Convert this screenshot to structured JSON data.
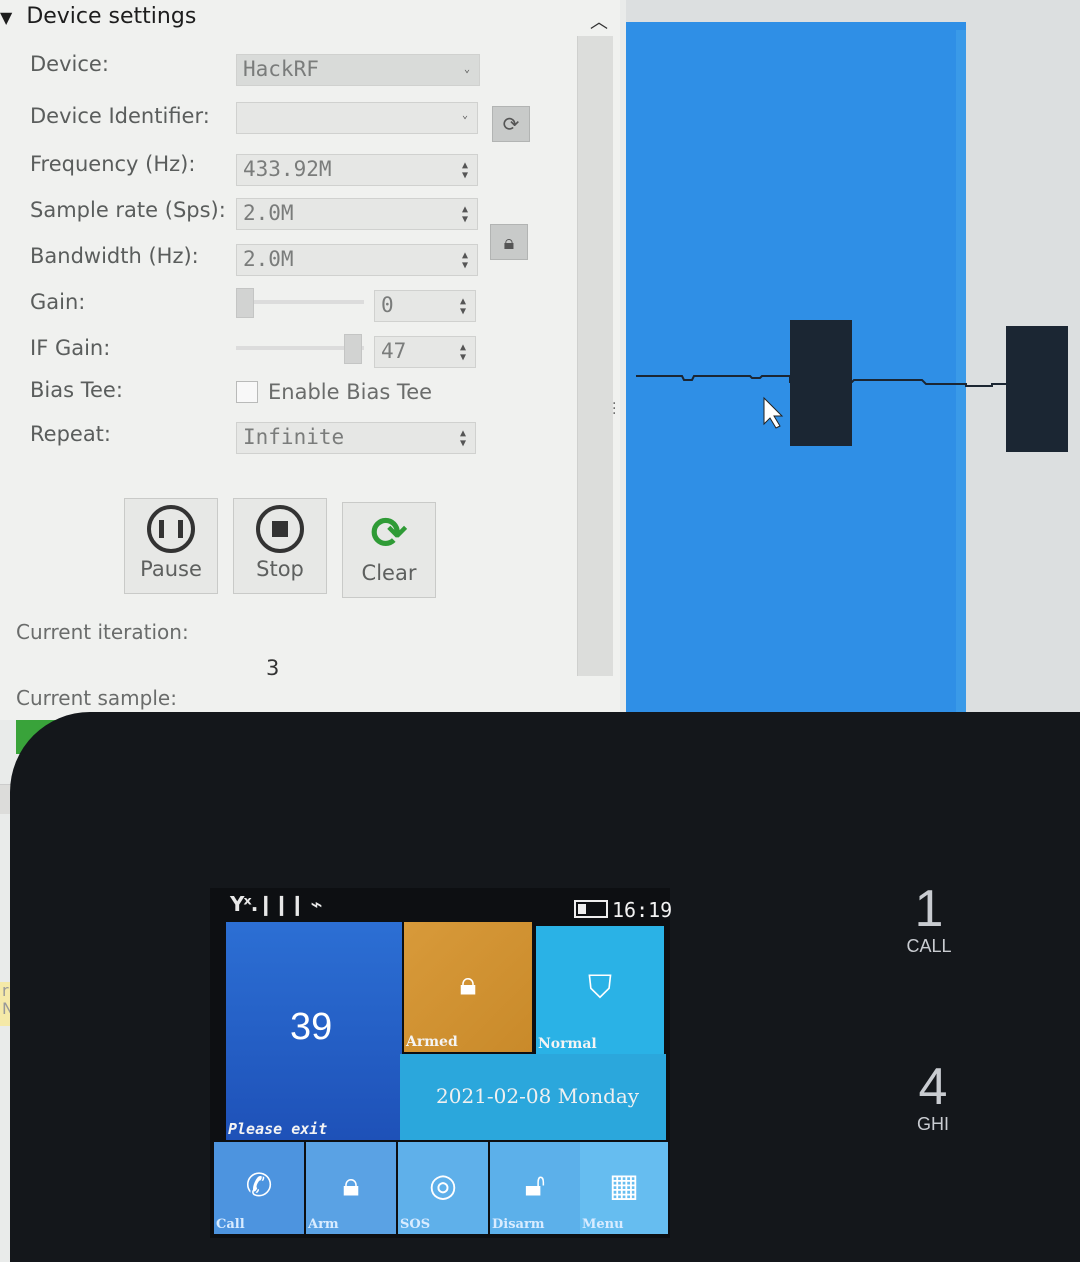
{
  "settings": {
    "header": "Device settings",
    "device_label": "Device:",
    "device_value": "HackRF",
    "identifier_label": "Device Identifier:",
    "identifier_value": "",
    "frequency_label": "Frequency (Hz):",
    "frequency_value": "433.92M",
    "sample_rate_label": "Sample rate (Sps):",
    "sample_rate_value": "2.0M",
    "bandwidth_label": "Bandwidth (Hz):",
    "bandwidth_value": "2.0M",
    "gain_label": "Gain:",
    "gain_value": "0",
    "if_gain_label": "IF Gain:",
    "if_gain_value": "47",
    "bias_tee_label": "Bias Tee:",
    "bias_tee_checkbox_label": "Enable Bias Tee",
    "bias_tee_checked": false,
    "repeat_label": "Repeat:",
    "repeat_value": "Infinite"
  },
  "controls": {
    "pause_label": "Pause",
    "stop_label": "Stop",
    "clear_label": "Clear"
  },
  "status": {
    "iteration_label": "Current iteration:",
    "iteration_value": "3",
    "sample_label": "Current sample:",
    "bottom_strip_text": "--",
    "terminal_text": "rur N"
  },
  "waveform": {
    "background_color": "#2f8fe6",
    "signal_color": "#1b2633"
  },
  "alarm_panel": {
    "clock": "16:19",
    "status_icons": "Yˣ.❙❙❙ ⌁",
    "tiles": {
      "countdown": "39",
      "countdown_caption": "Please exit",
      "armed_caption": "Armed",
      "normal_caption": "Normal",
      "date": "2021-02-08 Monday",
      "call_caption": "Call",
      "arm_caption": "Arm",
      "sos_caption": "SOS",
      "disarm_caption": "Disarm",
      "menu_caption": "Menu"
    },
    "keys": [
      {
        "digit": "1",
        "letters": "CALL"
      },
      {
        "digit": "4",
        "letters": "GHI"
      }
    ]
  },
  "icons": {
    "collapse": "chevron-up-icon",
    "refresh": "refresh-icon",
    "lock": "lock-icon",
    "pause": "pause-icon",
    "stop": "stop-icon",
    "clear": "clear-icon"
  }
}
